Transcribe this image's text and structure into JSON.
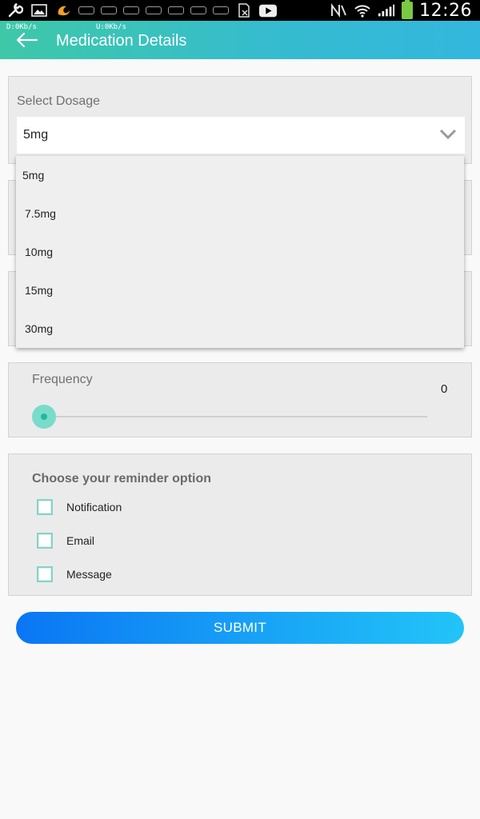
{
  "status_bar": {
    "time": "12:26",
    "icons": [
      "wrench-icon",
      "image-icon",
      "uc-browser-icon",
      "car-icon",
      "car-icon",
      "car-icon",
      "car-icon",
      "car-icon",
      "car-icon",
      "car-icon",
      "sim-off-icon",
      "youtube-icon",
      "nfc-icon",
      "wifi-icon",
      "signal-icon",
      "battery-icon"
    ]
  },
  "app_bar": {
    "net_down": "D:0Kb/s",
    "net_up": "U:0Kb/s",
    "title": "Medication Details"
  },
  "dosage": {
    "label": "Select Dosage",
    "selected": "5mg",
    "options": [
      "5mg",
      "7.5mg",
      "10mg",
      "15mg",
      "30mg"
    ]
  },
  "frequency": {
    "label": "Frequency",
    "value": "0"
  },
  "reminder": {
    "title": "Choose your reminder option",
    "options": [
      "Notification",
      "Email",
      "Message"
    ]
  },
  "submit_label": "SUBMIT",
  "colors": {
    "app_bar_start": "#3ec8a8",
    "app_bar_end": "#33b7de",
    "accent": "#22b8a0",
    "button_start": "#0a76f4",
    "button_end": "#22c4f8"
  }
}
